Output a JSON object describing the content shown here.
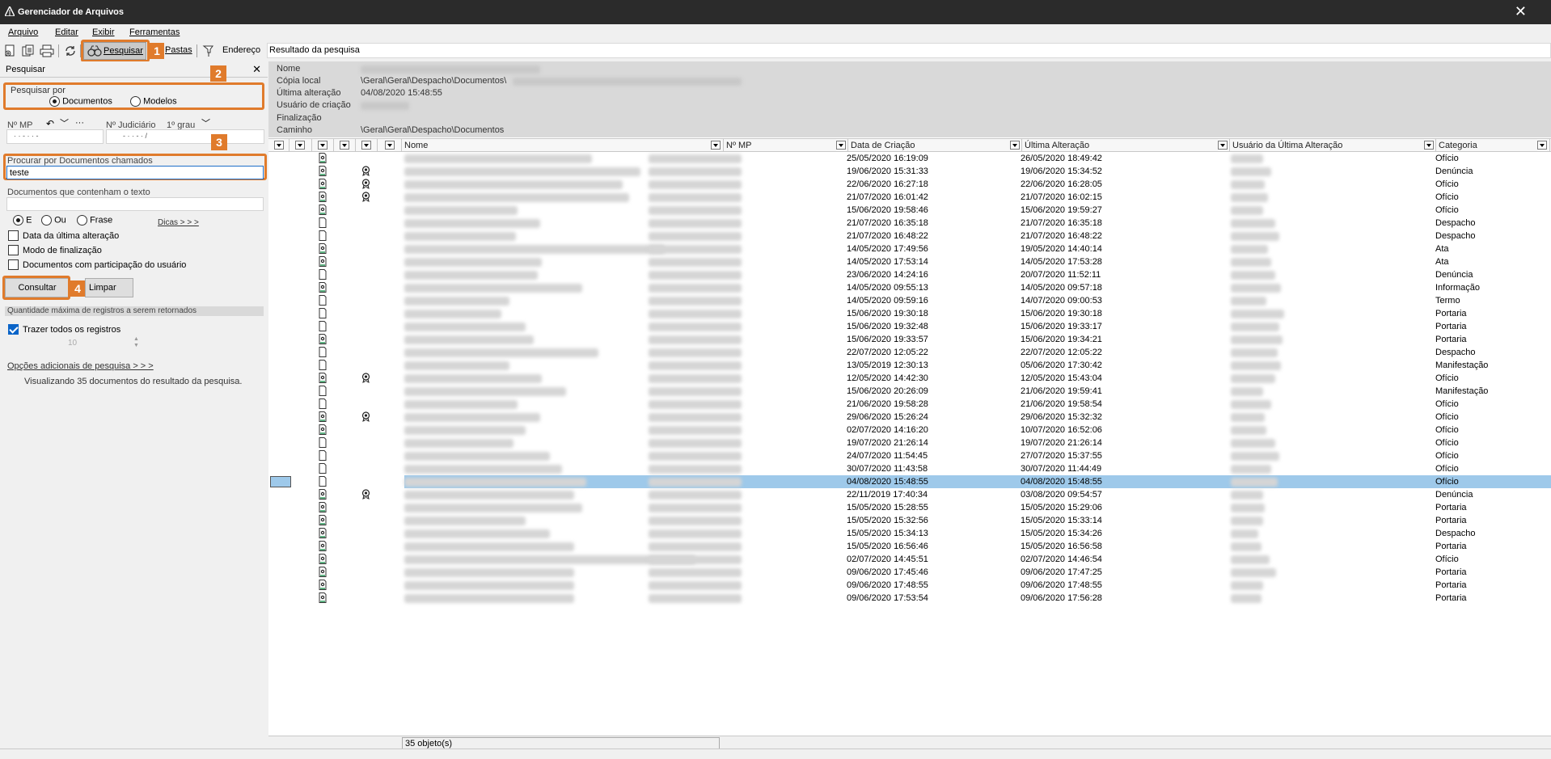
{
  "window": {
    "title": "Gerenciador de Arquivos",
    "close_glyph": "✕"
  },
  "menu": {
    "items": [
      "Arquivo",
      "Editar",
      "Exibir",
      "Ferramentas"
    ]
  },
  "toolbar": {
    "search_label": "Pesquisar",
    "folders_label": "Pastas",
    "address_label": "Endereço",
    "address_value": "Resultado da pesquisa",
    "icons": [
      "new-document-icon",
      "copy-document-icon",
      "print-icon",
      "refresh-icon",
      "binoculars-icon",
      "pin-icon"
    ]
  },
  "callouts": [
    "1",
    "2",
    "3",
    "4"
  ],
  "search_panel": {
    "title": "Pesquisar",
    "close_glyph": "✕",
    "search_by_label": "Pesquisar por",
    "search_by_options": [
      "Documentos",
      "Modelos"
    ],
    "search_by_selected": "Documentos",
    "mp_label": "Nº MP",
    "mp_value": "· · - · · -",
    "judicial_label": "Nº Judiciário",
    "degree_value": "1º grau",
    "judicial_value": "- · · - ·     /",
    "find_docs_label": "Procurar por Documentos chamados",
    "find_docs_value": "teste",
    "contains_text_label": "Documentos que contenham o texto",
    "contains_text_value": "",
    "logic_options": [
      "E",
      "Ou",
      "Frase"
    ],
    "logic_selected": "E",
    "tips_link": "Dicas > > >",
    "checkboxes": [
      {
        "label": "Data da última alteração",
        "checked": false
      },
      {
        "label": "Modo de finalização",
        "checked": false
      },
      {
        "label": "Documentos com participação do usuário",
        "checked": false
      }
    ],
    "query_button": "Consultar",
    "clear_button": "Limpar",
    "max_records_label": "Quantidade máxima de registros a serem retornados",
    "bring_all_label": "Trazer todos os registros",
    "bring_all_checked": true,
    "max_records_value": "10",
    "more_options_link": "Opções adicionais de pesquisa > > >",
    "summary": "Visualizando 35 documentos do resultado da pesquisa."
  },
  "properties": {
    "name_label": "Nome",
    "local_copy_label": "Cópia local",
    "local_copy_value": "\\Geral\\Geral\\Despacho\\Documentos\\",
    "last_change_label": "Última alteração",
    "last_change_value": "04/08/2020 15:48:55",
    "creator_label": "Usuário de criação",
    "finalization_label": "Finalização",
    "path_label": "Caminho",
    "path_value": "\\Geral\\Geral\\Despacho\\Documentos"
  },
  "grid": {
    "columns": [
      "Nome",
      "Nº MP",
      "Data de Criação",
      "Última Alteração",
      "Usuário da Última Alteração",
      "Categoria"
    ],
    "rows": [
      {
        "created": "25/05/2020 16:19:09",
        "changed": "26/05/2020 18:49:42",
        "category": "Ofício",
        "icon": "signed",
        "seal": false
      },
      {
        "created": "19/06/2020 15:31:33",
        "changed": "19/06/2020 15:34:52",
        "category": "Denúncia",
        "icon": "signed",
        "seal": true
      },
      {
        "created": "22/06/2020 16:27:18",
        "changed": "22/06/2020 16:28:05",
        "category": "Ofício",
        "icon": "signed",
        "seal": true
      },
      {
        "created": "21/07/2020 16:01:42",
        "changed": "21/07/2020 16:02:15",
        "category": "Ofício",
        "icon": "signed",
        "seal": true
      },
      {
        "created": "15/06/2020 19:58:46",
        "changed": "15/06/2020 19:59:27",
        "category": "Ofício",
        "icon": "signed",
        "seal": false
      },
      {
        "created": "21/07/2020 16:35:18",
        "changed": "21/07/2020 16:35:18",
        "category": "Despacho",
        "icon": "blank",
        "seal": false
      },
      {
        "created": "21/07/2020 16:48:22",
        "changed": "21/07/2020 16:48:22",
        "category": "Despacho",
        "icon": "blank",
        "seal": false
      },
      {
        "created": "14/05/2020 17:49:56",
        "changed": "19/05/2020 14:40:14",
        "category": "Ata",
        "icon": "signed",
        "seal": false
      },
      {
        "created": "14/05/2020 17:53:14",
        "changed": "14/05/2020 17:53:28",
        "category": "Ata",
        "icon": "signed",
        "seal": false
      },
      {
        "created": "23/06/2020 14:24:16",
        "changed": "20/07/2020 11:52:11",
        "category": "Denúncia",
        "icon": "blank",
        "seal": false
      },
      {
        "created": "14/05/2020 09:55:13",
        "changed": "14/05/2020 09:57:18",
        "category": "Informação",
        "icon": "signed",
        "seal": false
      },
      {
        "created": "14/05/2020 09:59:16",
        "changed": "14/07/2020 09:00:53",
        "category": "Termo",
        "icon": "blank",
        "seal": false
      },
      {
        "created": "15/06/2020 19:30:18",
        "changed": "15/06/2020 19:30:18",
        "category": "Portaria",
        "icon": "blank",
        "seal": false
      },
      {
        "created": "15/06/2020 19:32:48",
        "changed": "15/06/2020 19:33:17",
        "category": "Portaria",
        "icon": "blank",
        "seal": false
      },
      {
        "created": "15/06/2020 19:33:57",
        "changed": "15/06/2020 19:34:21",
        "category": "Portaria",
        "icon": "signed",
        "seal": false
      },
      {
        "created": "22/07/2020 12:05:22",
        "changed": "22/07/2020 12:05:22",
        "category": "Despacho",
        "icon": "blank",
        "seal": false
      },
      {
        "created": "13/05/2019 12:30:13",
        "changed": "05/06/2020 17:30:42",
        "category": "Manifestação",
        "icon": "blank",
        "seal": false
      },
      {
        "created": "12/05/2020 14:42:30",
        "changed": "12/05/2020 15:43:04",
        "category": "Ofício",
        "icon": "signed",
        "seal": true
      },
      {
        "created": "15/06/2020 20:26:09",
        "changed": "21/06/2020 19:59:41",
        "category": "Manifestação",
        "icon": "blank",
        "seal": false
      },
      {
        "created": "21/06/2020 19:58:28",
        "changed": "21/06/2020 19:58:54",
        "category": "Ofício",
        "icon": "blank",
        "seal": false
      },
      {
        "created": "29/06/2020 15:26:24",
        "changed": "29/06/2020 15:32:32",
        "category": "Ofício",
        "icon": "signed",
        "seal": true
      },
      {
        "created": "02/07/2020 14:16:20",
        "changed": "10/07/2020 16:52:06",
        "category": "Ofício",
        "icon": "signed",
        "seal": false
      },
      {
        "created": "19/07/2020 21:26:14",
        "changed": "19/07/2020 21:26:14",
        "category": "Ofício",
        "icon": "blank",
        "seal": false
      },
      {
        "created": "24/07/2020 11:54:45",
        "changed": "27/07/2020 15:37:55",
        "category": "Ofício",
        "icon": "blank",
        "seal": false
      },
      {
        "created": "30/07/2020 11:43:58",
        "changed": "30/07/2020 11:44:49",
        "category": "Ofício",
        "icon": "blank",
        "seal": false
      },
      {
        "created": "04/08/2020 15:48:55",
        "changed": "04/08/2020 15:48:55",
        "category": "Ofício",
        "icon": "blank",
        "seal": false,
        "selected": true
      },
      {
        "created": "22/11/2019 17:40:34",
        "changed": "03/08/2020 09:54:57",
        "category": "Denúncia",
        "icon": "signed",
        "seal": true
      },
      {
        "created": "15/05/2020 15:28:55",
        "changed": "15/05/2020 15:29:06",
        "category": "Portaria",
        "icon": "signed",
        "seal": false
      },
      {
        "created": "15/05/2020 15:32:56",
        "changed": "15/05/2020 15:33:14",
        "category": "Portaria",
        "icon": "signed",
        "seal": false
      },
      {
        "created": "15/05/2020 15:34:13",
        "changed": "15/05/2020 15:34:26",
        "category": "Despacho",
        "icon": "signed",
        "seal": false
      },
      {
        "created": "15/05/2020 16:56:46",
        "changed": "15/05/2020 16:56:58",
        "category": "Portaria",
        "icon": "signed",
        "seal": false
      },
      {
        "created": "02/07/2020 14:45:51",
        "changed": "02/07/2020 14:46:54",
        "category": "Ofício",
        "icon": "signed",
        "seal": false
      },
      {
        "created": "09/06/2020 17:45:46",
        "changed": "09/06/2020 17:47:25",
        "category": "Portaria",
        "icon": "signed",
        "seal": false
      },
      {
        "created": "09/06/2020 17:48:55",
        "changed": "09/06/2020 17:48:55",
        "category": "Portaria",
        "icon": "signed",
        "seal": false
      },
      {
        "created": "09/06/2020 17:53:54",
        "changed": "09/06/2020 17:56:28",
        "category": "Portaria",
        "icon": "signed",
        "seal": false
      }
    ]
  },
  "status": {
    "count": "35 objeto(s)"
  },
  "colors": {
    "accent_callout": "#e07b2c",
    "selection": "#9ec9ea",
    "titlebar": "#2b2b2b"
  }
}
